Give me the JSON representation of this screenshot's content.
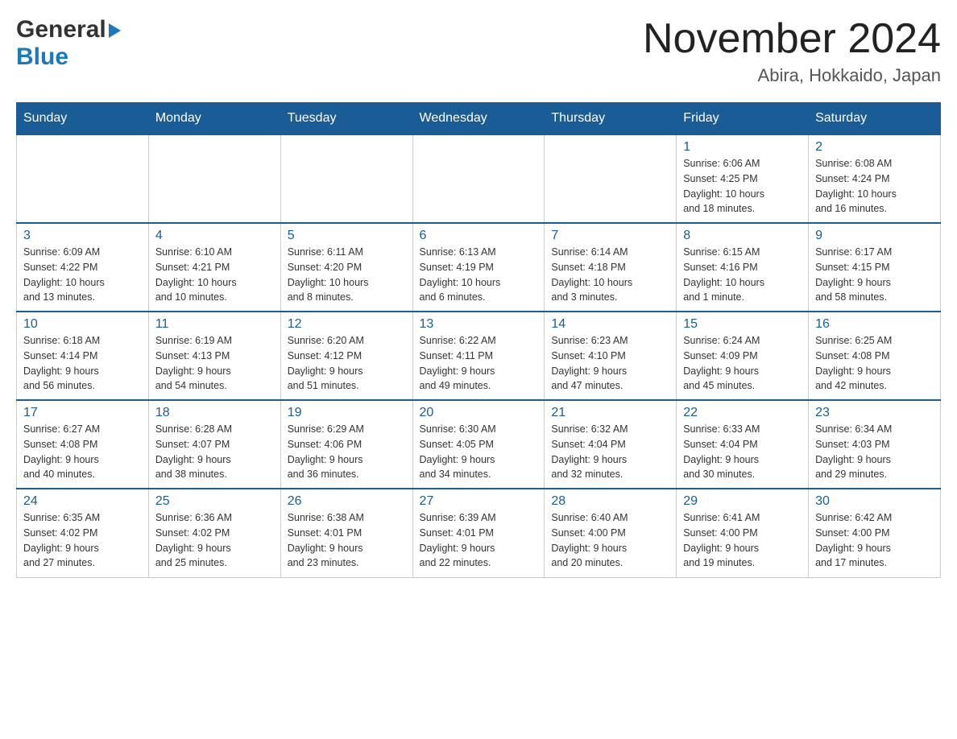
{
  "header": {
    "logo_text1": "General",
    "logo_text2": "Blue",
    "title": "November 2024",
    "subtitle": "Abira, Hokkaido, Japan"
  },
  "days_of_week": [
    "Sunday",
    "Monday",
    "Tuesday",
    "Wednesday",
    "Thursday",
    "Friday",
    "Saturday"
  ],
  "weeks": [
    [
      {
        "day": "",
        "info": ""
      },
      {
        "day": "",
        "info": ""
      },
      {
        "day": "",
        "info": ""
      },
      {
        "day": "",
        "info": ""
      },
      {
        "day": "",
        "info": ""
      },
      {
        "day": "1",
        "info": "Sunrise: 6:06 AM\nSunset: 4:25 PM\nDaylight: 10 hours\nand 18 minutes."
      },
      {
        "day": "2",
        "info": "Sunrise: 6:08 AM\nSunset: 4:24 PM\nDaylight: 10 hours\nand 16 minutes."
      }
    ],
    [
      {
        "day": "3",
        "info": "Sunrise: 6:09 AM\nSunset: 4:22 PM\nDaylight: 10 hours\nand 13 minutes."
      },
      {
        "day": "4",
        "info": "Sunrise: 6:10 AM\nSunset: 4:21 PM\nDaylight: 10 hours\nand 10 minutes."
      },
      {
        "day": "5",
        "info": "Sunrise: 6:11 AM\nSunset: 4:20 PM\nDaylight: 10 hours\nand 8 minutes."
      },
      {
        "day": "6",
        "info": "Sunrise: 6:13 AM\nSunset: 4:19 PM\nDaylight: 10 hours\nand 6 minutes."
      },
      {
        "day": "7",
        "info": "Sunrise: 6:14 AM\nSunset: 4:18 PM\nDaylight: 10 hours\nand 3 minutes."
      },
      {
        "day": "8",
        "info": "Sunrise: 6:15 AM\nSunset: 4:16 PM\nDaylight: 10 hours\nand 1 minute."
      },
      {
        "day": "9",
        "info": "Sunrise: 6:17 AM\nSunset: 4:15 PM\nDaylight: 9 hours\nand 58 minutes."
      }
    ],
    [
      {
        "day": "10",
        "info": "Sunrise: 6:18 AM\nSunset: 4:14 PM\nDaylight: 9 hours\nand 56 minutes."
      },
      {
        "day": "11",
        "info": "Sunrise: 6:19 AM\nSunset: 4:13 PM\nDaylight: 9 hours\nand 54 minutes."
      },
      {
        "day": "12",
        "info": "Sunrise: 6:20 AM\nSunset: 4:12 PM\nDaylight: 9 hours\nand 51 minutes."
      },
      {
        "day": "13",
        "info": "Sunrise: 6:22 AM\nSunset: 4:11 PM\nDaylight: 9 hours\nand 49 minutes."
      },
      {
        "day": "14",
        "info": "Sunrise: 6:23 AM\nSunset: 4:10 PM\nDaylight: 9 hours\nand 47 minutes."
      },
      {
        "day": "15",
        "info": "Sunrise: 6:24 AM\nSunset: 4:09 PM\nDaylight: 9 hours\nand 45 minutes."
      },
      {
        "day": "16",
        "info": "Sunrise: 6:25 AM\nSunset: 4:08 PM\nDaylight: 9 hours\nand 42 minutes."
      }
    ],
    [
      {
        "day": "17",
        "info": "Sunrise: 6:27 AM\nSunset: 4:08 PM\nDaylight: 9 hours\nand 40 minutes."
      },
      {
        "day": "18",
        "info": "Sunrise: 6:28 AM\nSunset: 4:07 PM\nDaylight: 9 hours\nand 38 minutes."
      },
      {
        "day": "19",
        "info": "Sunrise: 6:29 AM\nSunset: 4:06 PM\nDaylight: 9 hours\nand 36 minutes."
      },
      {
        "day": "20",
        "info": "Sunrise: 6:30 AM\nSunset: 4:05 PM\nDaylight: 9 hours\nand 34 minutes."
      },
      {
        "day": "21",
        "info": "Sunrise: 6:32 AM\nSunset: 4:04 PM\nDaylight: 9 hours\nand 32 minutes."
      },
      {
        "day": "22",
        "info": "Sunrise: 6:33 AM\nSunset: 4:04 PM\nDaylight: 9 hours\nand 30 minutes."
      },
      {
        "day": "23",
        "info": "Sunrise: 6:34 AM\nSunset: 4:03 PM\nDaylight: 9 hours\nand 29 minutes."
      }
    ],
    [
      {
        "day": "24",
        "info": "Sunrise: 6:35 AM\nSunset: 4:02 PM\nDaylight: 9 hours\nand 27 minutes."
      },
      {
        "day": "25",
        "info": "Sunrise: 6:36 AM\nSunset: 4:02 PM\nDaylight: 9 hours\nand 25 minutes."
      },
      {
        "day": "26",
        "info": "Sunrise: 6:38 AM\nSunset: 4:01 PM\nDaylight: 9 hours\nand 23 minutes."
      },
      {
        "day": "27",
        "info": "Sunrise: 6:39 AM\nSunset: 4:01 PM\nDaylight: 9 hours\nand 22 minutes."
      },
      {
        "day": "28",
        "info": "Sunrise: 6:40 AM\nSunset: 4:00 PM\nDaylight: 9 hours\nand 20 minutes."
      },
      {
        "day": "29",
        "info": "Sunrise: 6:41 AM\nSunset: 4:00 PM\nDaylight: 9 hours\nand 19 minutes."
      },
      {
        "day": "30",
        "info": "Sunrise: 6:42 AM\nSunset: 4:00 PM\nDaylight: 9 hours\nand 17 minutes."
      }
    ]
  ]
}
